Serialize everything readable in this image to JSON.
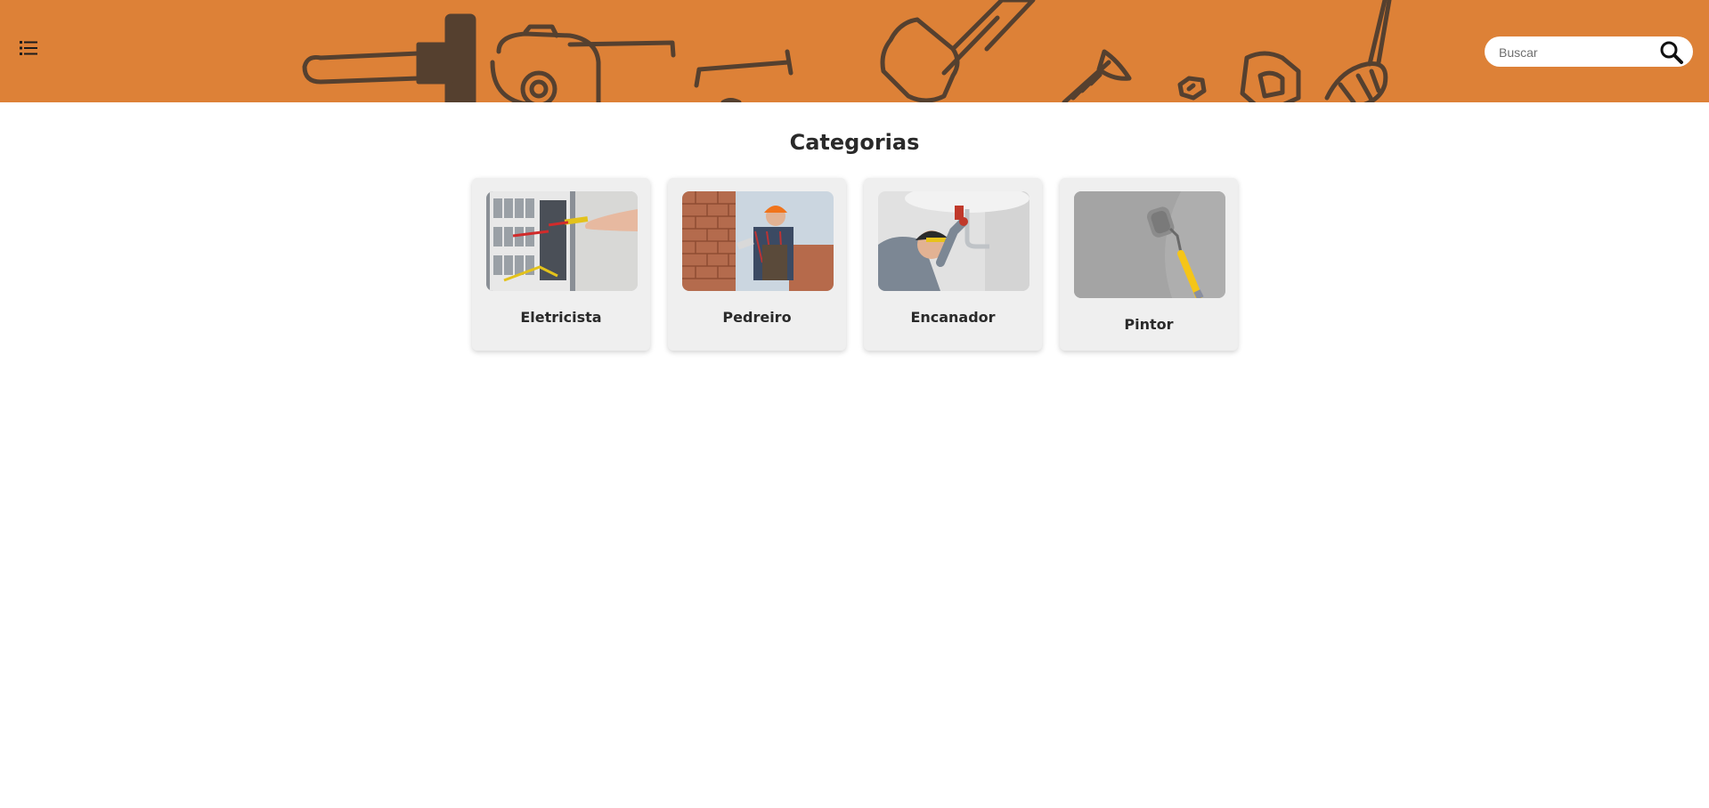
{
  "header": {
    "background_color": "#dd8137",
    "art_color": "#55402f",
    "menu_icon": "list-icon",
    "search": {
      "placeholder": "Buscar",
      "value": "",
      "icon": "search-icon"
    }
  },
  "main": {
    "title": "Categorias",
    "categories": [
      {
        "label": "Eletricista",
        "image": "electrician-photo"
      },
      {
        "label": "Pedreiro",
        "image": "bricklayer-photo"
      },
      {
        "label": "Encanador",
        "image": "plumber-photo"
      },
      {
        "label": "Pintor",
        "image": "painter-photo"
      }
    ]
  }
}
